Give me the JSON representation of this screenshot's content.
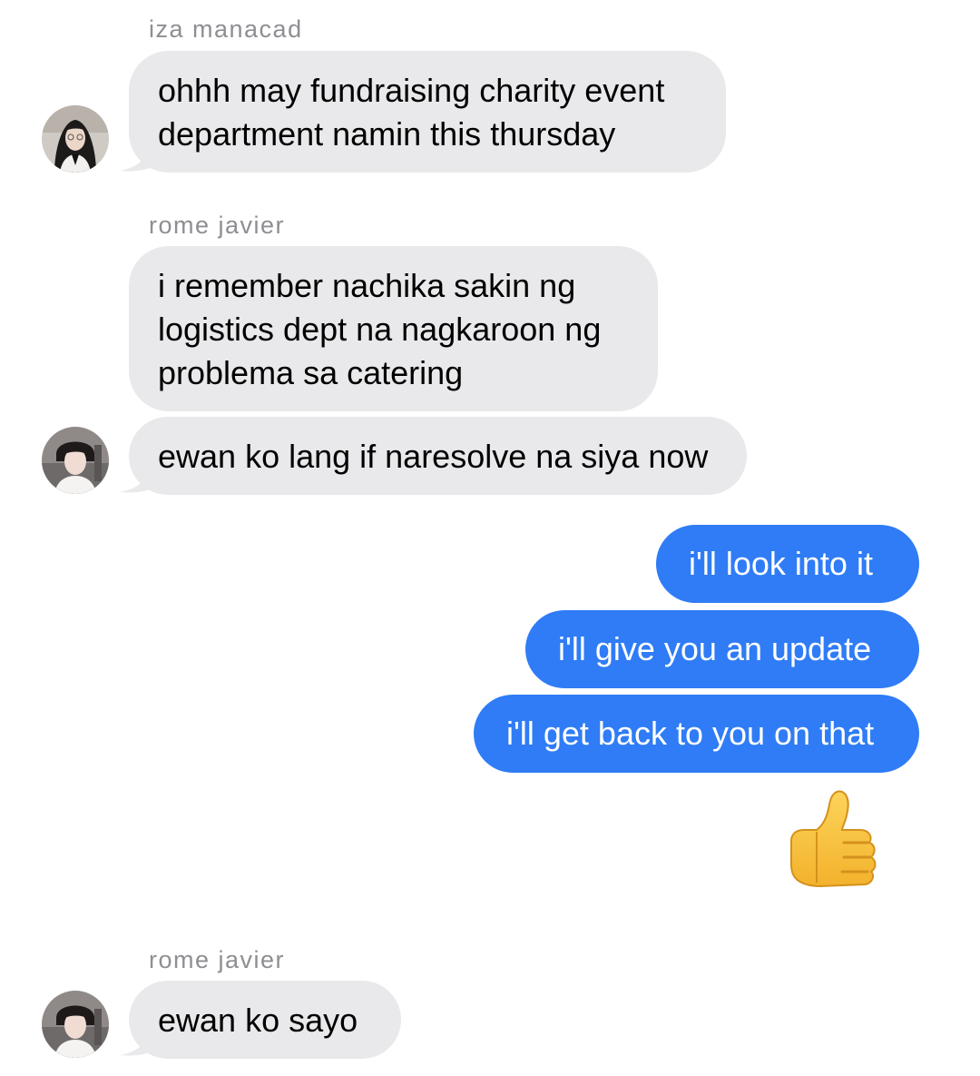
{
  "conversation": {
    "groups": [
      {
        "sender": "iza manacad",
        "messages": [
          {
            "lines": [
              "ohhh may fundraising charity event",
              "department namin this thursday"
            ]
          }
        ]
      },
      {
        "sender": "rome javier",
        "messages": [
          {
            "lines": [
              "i remember nachika sakin ng",
              "logistics dept na nagkaroon ng",
              "problema sa catering"
            ]
          },
          {
            "lines": [
              "ewan ko lang if naresolve na siya now"
            ]
          }
        ]
      },
      {
        "sender": "",
        "messages": [
          {
            "lines": [
              "i'll look into it"
            ]
          },
          {
            "lines": [
              "i'll give you an update"
            ]
          },
          {
            "lines": [
              "i'll get back to you on that"
            ]
          }
        ],
        "reaction": "thumbs-up-icon"
      },
      {
        "sender": "rome javier",
        "messages": [
          {
            "lines": [
              "ewan ko sayo"
            ]
          }
        ]
      }
    ]
  },
  "colors": {
    "incoming_bubble": "#e9e9eb",
    "outgoing_bubble": "#2f7cf6",
    "sender_name": "#8e8e93"
  }
}
